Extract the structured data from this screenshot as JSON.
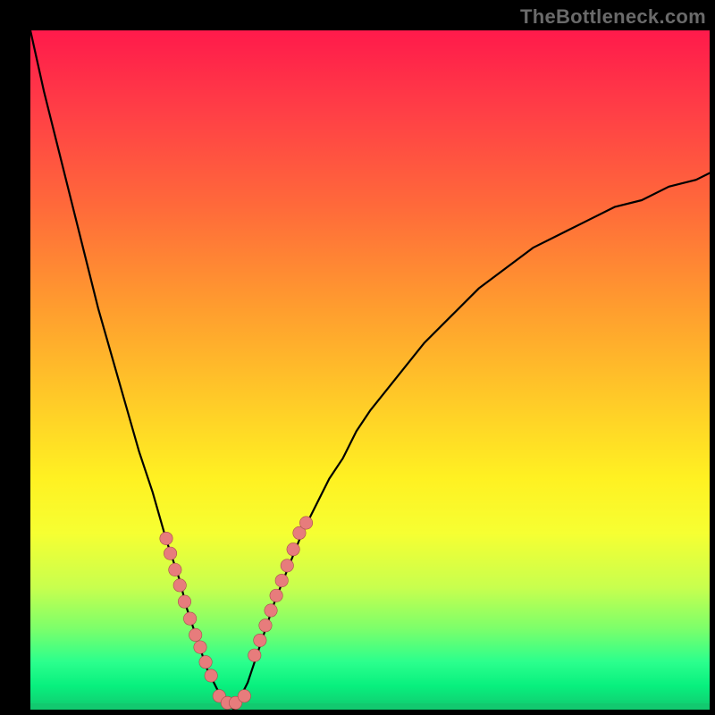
{
  "watermark": "TheBottleneck.com",
  "colors": {
    "curve": "#000000",
    "dots": "#e77c7c",
    "dot_stroke": "#a84d4d",
    "green_band": "#12c96f"
  },
  "chart_data": {
    "type": "line",
    "title": "",
    "xlabel": "",
    "ylabel": "",
    "xlim": [
      0,
      100
    ],
    "ylim": [
      0,
      100
    ],
    "grid": false,
    "legend": false,
    "annotations": [],
    "series": [
      {
        "name": "bottleneck-curve-left",
        "x": [
          0,
          2,
          4,
          6,
          8,
          10,
          12,
          14,
          16,
          18,
          20,
          21,
          22,
          23,
          24,
          25,
          26,
          27,
          28,
          29,
          30
        ],
        "values": [
          100,
          91,
          83,
          75,
          67,
          59,
          52,
          45,
          38,
          32,
          25,
          22,
          19,
          15,
          12,
          9,
          6,
          4,
          2,
          1,
          0
        ]
      },
      {
        "name": "bottleneck-curve-right",
        "x": [
          30,
          31,
          32,
          33,
          34,
          35,
          36,
          38,
          40,
          42,
          44,
          46,
          48,
          50,
          54,
          58,
          62,
          66,
          70,
          74,
          78,
          82,
          86,
          90,
          94,
          98,
          100
        ],
        "values": [
          0,
          2,
          4,
          7,
          10,
          13,
          16,
          21,
          26,
          30,
          34,
          37,
          41,
          44,
          49,
          54,
          58,
          62,
          65,
          68,
          70,
          72,
          74,
          75,
          77,
          78,
          79
        ]
      },
      {
        "name": "dots-left-arm",
        "x": [
          20.0,
          20.6,
          21.3,
          22.0,
          22.7,
          23.5,
          24.3,
          25.0,
          25.8,
          26.6
        ],
        "values": [
          25.2,
          23.0,
          20.6,
          18.3,
          15.9,
          13.4,
          11.0,
          9.2,
          7.0,
          5.0
        ]
      },
      {
        "name": "dots-valley",
        "x": [
          27.8,
          29.0,
          30.2,
          31.5
        ],
        "values": [
          2.0,
          1.0,
          1.0,
          2.0
        ]
      },
      {
        "name": "dots-right-arm",
        "x": [
          33.0,
          33.8,
          34.6,
          35.4,
          36.2,
          37.0,
          37.8,
          38.7,
          39.6,
          40.6
        ],
        "values": [
          8.0,
          10.2,
          12.4,
          14.6,
          16.8,
          19.0,
          21.2,
          23.6,
          26.0,
          27.5
        ]
      }
    ]
  }
}
